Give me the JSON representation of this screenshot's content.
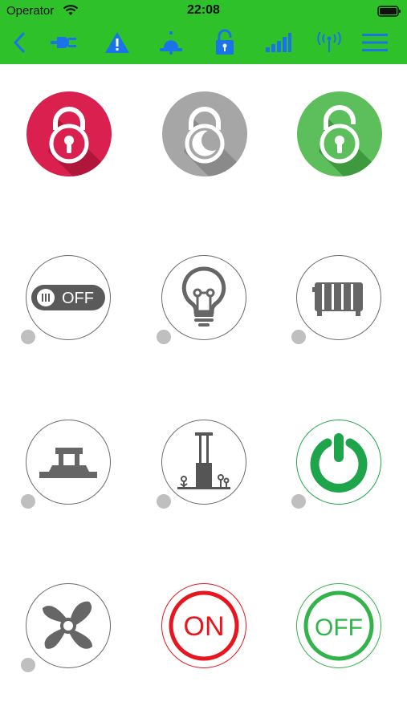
{
  "status_bar": {
    "carrier": "Operator",
    "time": "22:08"
  },
  "toolbar": {
    "accent": "#1a73e8",
    "background": "#2fc12a",
    "icons": [
      "back-chevron-icon",
      "plug-icon",
      "warning-icon",
      "bell-icon",
      "lock-icon",
      "signal-bars-icon",
      "antenna-icon",
      "menu-icon"
    ]
  },
  "grid": {
    "row1": [
      "lock-closed-red",
      "lock-gray",
      "lock-open-green"
    ],
    "row2": [
      "toggle-off-switch",
      "light-bulb",
      "radiator"
    ],
    "row3": [
      "gate-valve",
      "sprinkler",
      "power-button"
    ],
    "row4": [
      "fan",
      "on-button",
      "off-button"
    ],
    "toggle_label": "OFF",
    "on_label": "ON",
    "off_label": "OFF",
    "colors": {
      "red": "#d9204f",
      "gray": "#a6a6a6",
      "green": "#5cbf5c",
      "icon_gray": "#666666",
      "power_green": "#1ea54b",
      "on_red": "#e8141e",
      "off_green": "#32b44a"
    }
  }
}
